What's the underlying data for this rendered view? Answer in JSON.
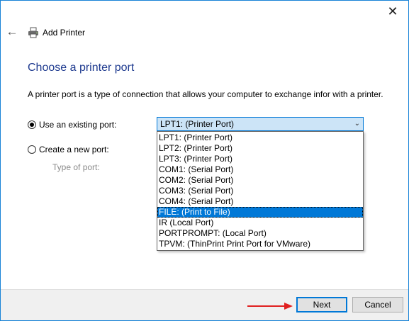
{
  "window": {
    "title": "Add Printer",
    "close_label": "✕",
    "back_label": "←"
  },
  "page": {
    "heading": "Choose a printer port",
    "description": "A printer port is a type of connection that allows your computer to exchange infor with a printer."
  },
  "options": {
    "existing_label": "Use an existing port:",
    "new_label": "Create a new port:",
    "type_label": "Type of port:"
  },
  "port_select": {
    "value": "LPT1: (Printer Port)",
    "items": [
      "LPT1: (Printer Port)",
      "LPT2: (Printer Port)",
      "LPT3: (Printer Port)",
      "COM1: (Serial Port)",
      "COM2: (Serial Port)",
      "COM3: (Serial Port)",
      "COM4: (Serial Port)",
      "FILE: (Print to File)",
      "IR (Local Port)",
      "PORTPROMPT: (Local Port)",
      "TPVM: (ThinPrint Print Port for VMware)"
    ],
    "highlighted_index": 7
  },
  "footer": {
    "next_label": "Next",
    "cancel_label": "Cancel"
  },
  "colors": {
    "heading": "#1e3a8f",
    "accent": "#0078d7",
    "annotation_arrow": "#e02020"
  }
}
